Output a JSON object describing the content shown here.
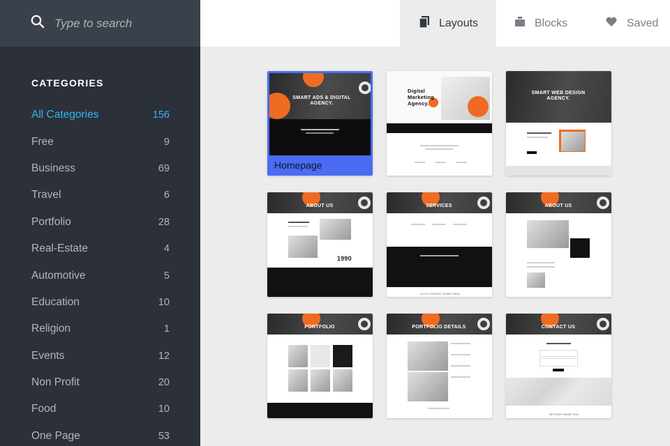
{
  "search": {
    "placeholder": "Type to search"
  },
  "sidebar": {
    "heading": "CATEGORIES",
    "categories": [
      {
        "label": "All Categories",
        "count": "156",
        "active": true
      },
      {
        "label": "Free",
        "count": "9"
      },
      {
        "label": "Business",
        "count": "69"
      },
      {
        "label": "Travel",
        "count": "6"
      },
      {
        "label": "Portfolio",
        "count": "28"
      },
      {
        "label": "Real-Estate",
        "count": "4"
      },
      {
        "label": "Automotive",
        "count": "5"
      },
      {
        "label": "Education",
        "count": "10"
      },
      {
        "label": "Religion",
        "count": "1"
      },
      {
        "label": "Events",
        "count": "12"
      },
      {
        "label": "Non Profit",
        "count": "20"
      },
      {
        "label": "Food",
        "count": "10"
      },
      {
        "label": "One Page",
        "count": "53"
      }
    ]
  },
  "tabs": {
    "layouts": {
      "label": "Layouts",
      "icon": "pages-icon",
      "active": true
    },
    "blocks": {
      "label": "Blocks",
      "icon": "blocks-icon"
    },
    "saved": {
      "label": "Saved",
      "icon": "heart-icon"
    }
  },
  "colors": {
    "sidebar_bg": "#2b3039",
    "search_bg": "#3a414a",
    "accent": "#33b5f0",
    "selected_card": "#4a6cf2",
    "brand_orange": "#ef6b22"
  },
  "templates": [
    {
      "selected": true,
      "label": "Homepage",
      "thumb_title": "SMART ADS & DIGITAL AGENCY."
    },
    {
      "thumb_title": "Digital Marketing Agency."
    },
    {
      "thumb_title": "SMART WEB DESIGN AGENCY."
    },
    {
      "thumb_title": "ABOUT US",
      "thumb_number": "1990"
    },
    {
      "thumb_title": "SERVICES",
      "thumb_footer": "LET'S CREATE SOMETHING"
    },
    {
      "thumb_title": "ABOUT US"
    },
    {
      "thumb_title": "PORTFOLIO"
    },
    {
      "thumb_title": "PORTFOLIO DETAILS"
    },
    {
      "thumb_title": "CONTACT US",
      "thumb_footer": "OFFICES NEAR YOU"
    }
  ]
}
